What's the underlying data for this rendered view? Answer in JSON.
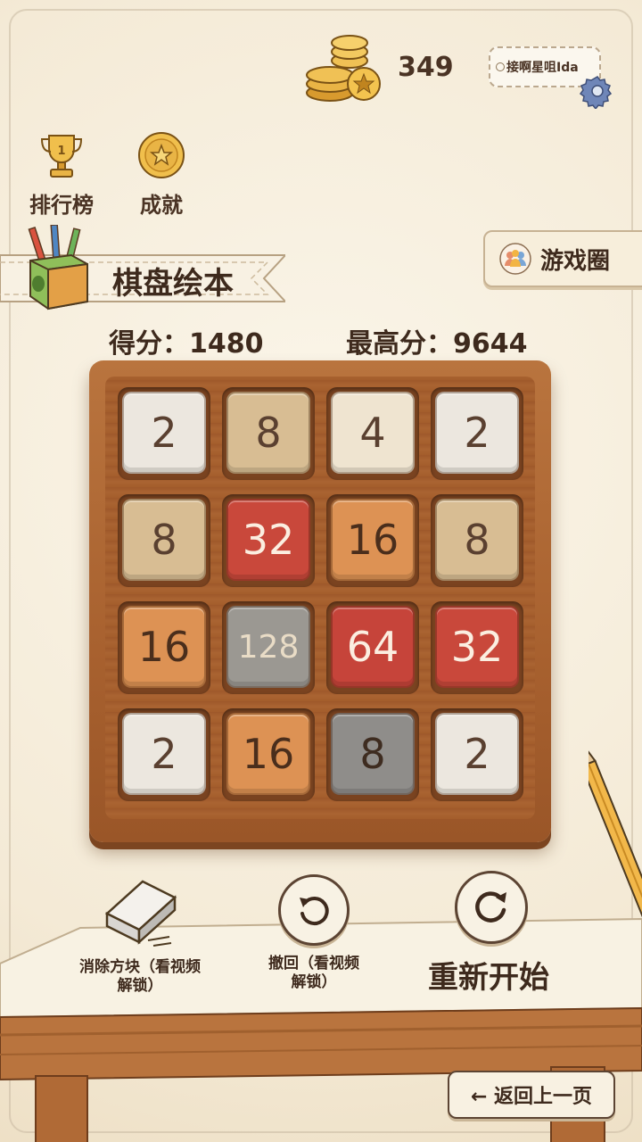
{
  "header": {
    "coin_count": "349",
    "username": "接啊星咀Ida"
  },
  "left_menu": {
    "leaderboard_label": "排行榜",
    "achievements_label": "成就"
  },
  "banner": {
    "title": "棋盘绘本"
  },
  "game_circle": {
    "label": "游戏圈"
  },
  "scores": {
    "score_text": "得分：1480",
    "best_text": "最高分：9644"
  },
  "board": {
    "rows": [
      [
        "2",
        "8",
        "4",
        "2"
      ],
      [
        "8",
        "32",
        "16",
        "8"
      ],
      [
        "16",
        "128",
        "64",
        "32"
      ],
      [
        "2",
        "16",
        "8",
        "2"
      ]
    ]
  },
  "tile_colors": {
    "2": {
      "bg": "#ece7df",
      "fg": "#5a4030"
    },
    "4": {
      "bg": "#efe4d0",
      "fg": "#5a4030"
    },
    "8": {
      "bg": "#d8bd93",
      "fg": "#5a4030"
    },
    "8g": {
      "bg": "#8f8d8a",
      "fg": "#3e2c20"
    },
    "16": {
      "bg": "#dd9254",
      "fg": "#4a2e1c"
    },
    "32": {
      "bg": "#c9483b",
      "fg": "#fbeee0"
    },
    "64": {
      "bg": "#c6443a",
      "fg": "#fbeee0"
    },
    "128": {
      "bg": "#9b9892",
      "fg": "#e9dcc6"
    }
  },
  "tools": {
    "eraser_label": "消除方块（看视频解锁）",
    "undo_label": "撤回（看视频解锁）",
    "restart_label": "重新开始"
  },
  "footer": {
    "back_label": "← 返回上一页"
  }
}
